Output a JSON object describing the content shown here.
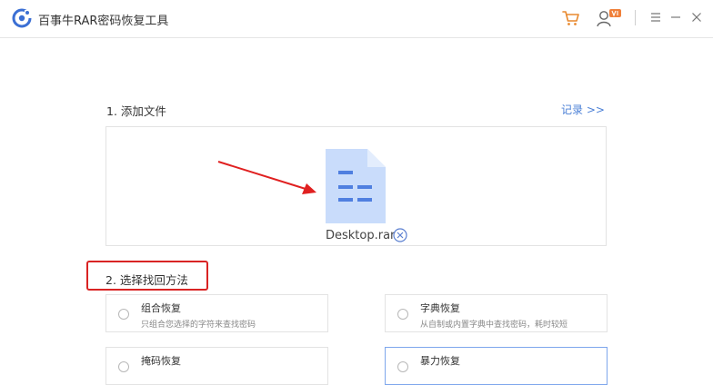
{
  "app": {
    "title": "百事牛RAR密码恢复工具",
    "icons": [
      "app-logo-icon",
      "cart-icon",
      "user-vip-icon",
      "menu-icon",
      "minimize-icon",
      "close-icon"
    ],
    "user_badge_color": "#f0803a",
    "accent_color": "#4a7fd6"
  },
  "section1": {
    "title": "1. 添加文件",
    "records_link": "记录 >>",
    "file": {
      "name": "Desktop.rar",
      "icon": "document-file-icon"
    }
  },
  "section2": {
    "title": "2. 选择找回方法",
    "options": [
      {
        "label": "组合恢复",
        "desc": "只组合您选择的字符来查找密码",
        "selected": false
      },
      {
        "label": "字典恢复",
        "desc": "从自制或内置字典中查找密码，耗时较短",
        "selected": false
      },
      {
        "label": "掩码恢复",
        "desc": "",
        "selected": false
      },
      {
        "label": "暴力恢复",
        "desc": "",
        "selected": true
      }
    ]
  },
  "annotations": {
    "arrow_color": "#e02020",
    "highlight_box_color": "#d92323"
  }
}
